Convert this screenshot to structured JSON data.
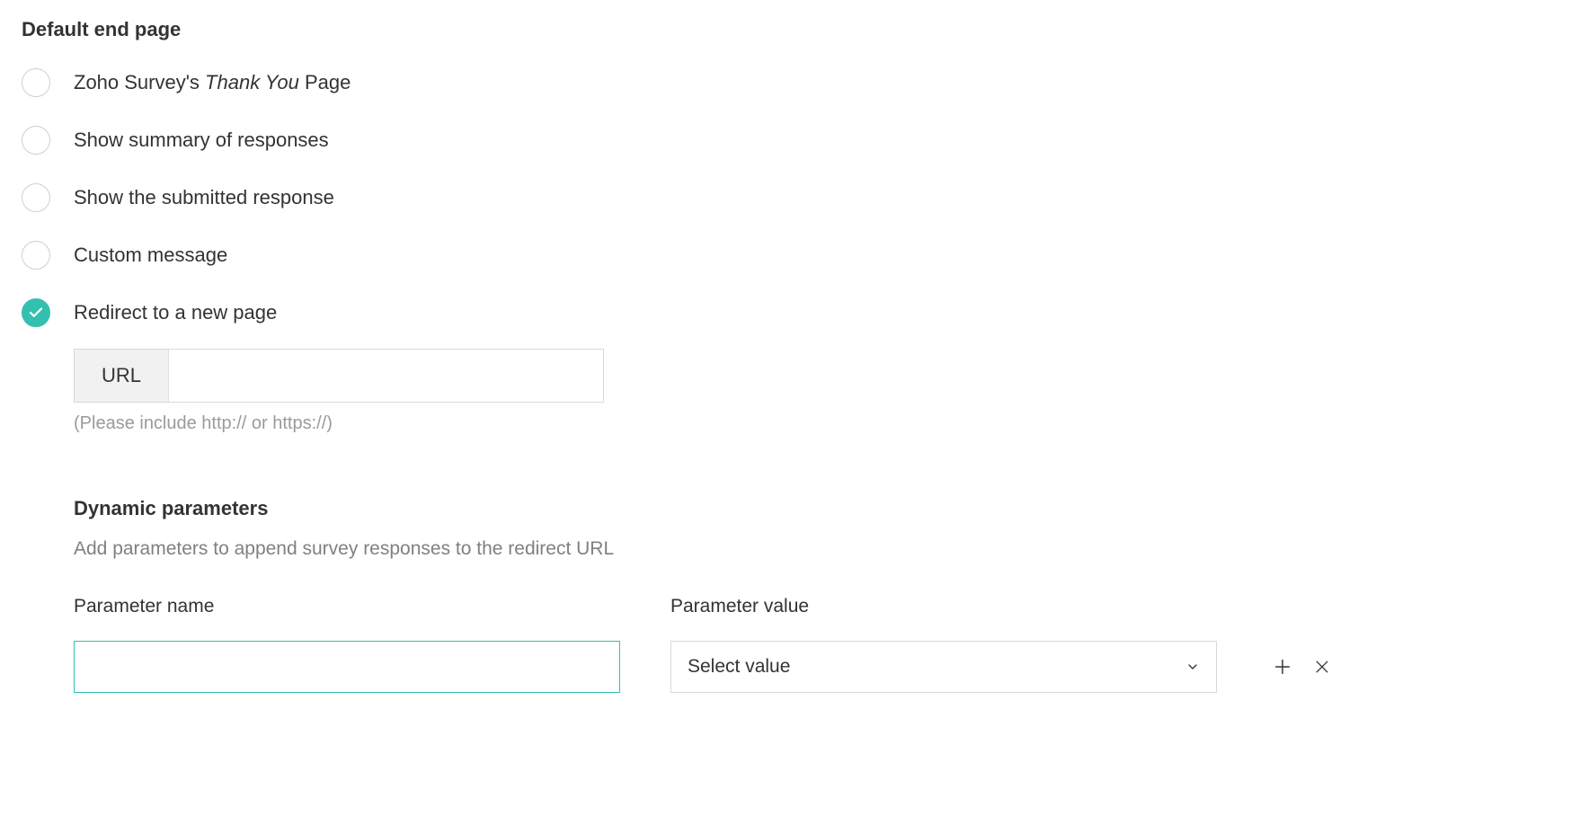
{
  "section_title": "Default end page",
  "options": {
    "thank_you": {
      "prefix": "Zoho Survey's ",
      "italic": "Thank You",
      "suffix": " Page"
    },
    "summary": "Show summary of responses",
    "submitted": "Show the submitted response",
    "custom": "Custom message",
    "redirect": "Redirect to a new page"
  },
  "url_block": {
    "prefix_label": "URL",
    "value": "",
    "help": "(Please include http:// or https://)"
  },
  "dynamic": {
    "title": "Dynamic parameters",
    "description": "Add parameters to append survey responses to the redirect URL",
    "param_name_label": "Parameter name",
    "param_value_label": "Parameter value",
    "param_name_value": "",
    "param_value_placeholder": "Select value"
  }
}
